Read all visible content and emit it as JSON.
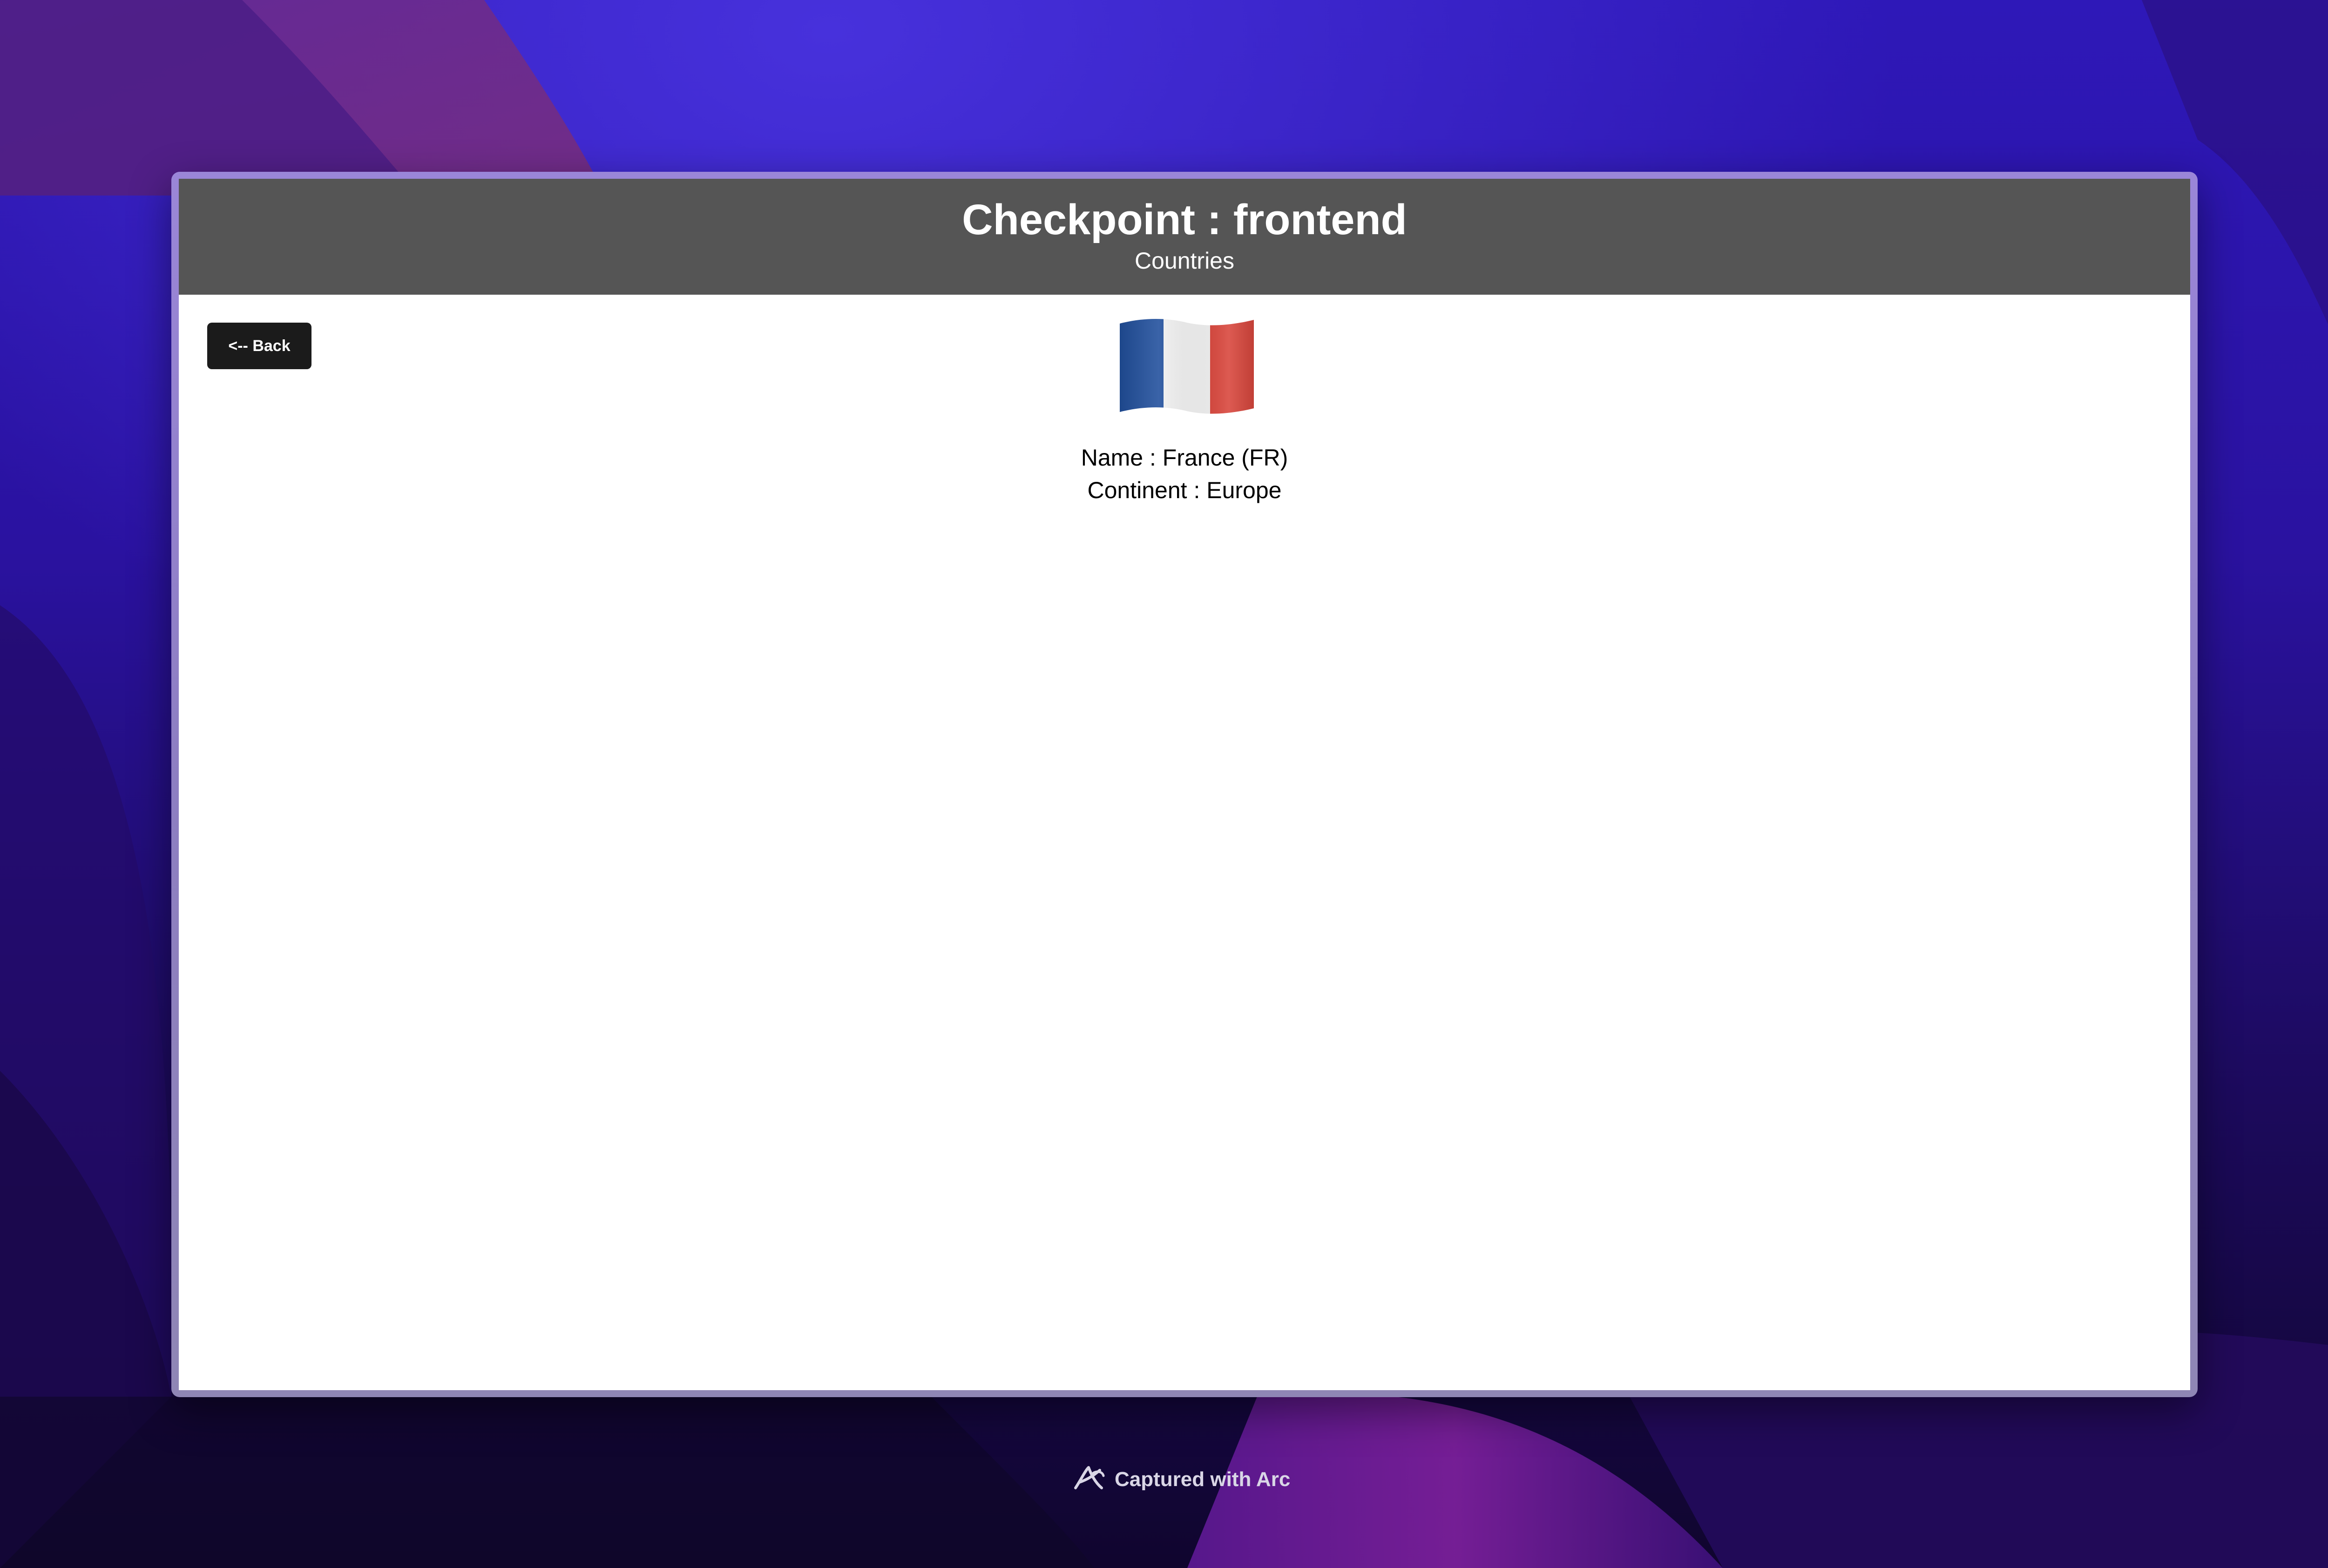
{
  "header": {
    "title": "Checkpoint : frontend",
    "subtitle": "Countries"
  },
  "back_button": {
    "label": "<-- Back"
  },
  "country": {
    "flag_icon": "france-flag-icon",
    "name_line": "Name : France (FR)",
    "continent_line": "Continent : Europe"
  },
  "footer": {
    "capture_text": "Captured with Arc",
    "icon": "arc-logo-icon"
  },
  "colors": {
    "header_bg": "#555555",
    "button_bg": "#1b1b1b",
    "window_bg": "#ffffff",
    "wallpaper_deep": "#16083f",
    "wallpaper_violet": "#3a19c6",
    "wallpaper_magenta": "#8a2a8a",
    "window_frame": "#9a86d8",
    "flag_blue": "#1f4e9c",
    "flag_white": "#f2f2f2",
    "flag_red": "#d8443a"
  }
}
